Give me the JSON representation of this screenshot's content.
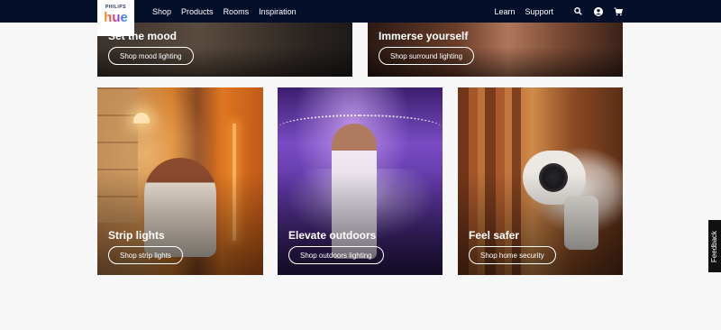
{
  "brand": {
    "line1": "PHILIPS",
    "line2": "hue"
  },
  "nav": {
    "left": [
      "Shop",
      "Products",
      "Rooms",
      "Inspiration"
    ],
    "right": [
      "Learn",
      "Support"
    ],
    "icons": [
      "search-icon",
      "account-icon",
      "cart-icon"
    ]
  },
  "cards": {
    "mood": {
      "title": "Set the mood",
      "button": "Shop mood lighting"
    },
    "immerse": {
      "title": "Immerse yourself",
      "button": "Shop surround lighting"
    },
    "strip": {
      "title": "Strip lights",
      "button": "Shop strip lights"
    },
    "outdoor": {
      "title": "Elevate outdoors",
      "button": "Shop outdoors lighting"
    },
    "safer": {
      "title": "Feel safer",
      "button": "Shop home security"
    }
  },
  "feedback": {
    "label": "Feedback"
  },
  "colors": {
    "nav_bg": "#04102a",
    "page_bg": "#f7f7f7",
    "text_on_image": "#ffffff"
  }
}
